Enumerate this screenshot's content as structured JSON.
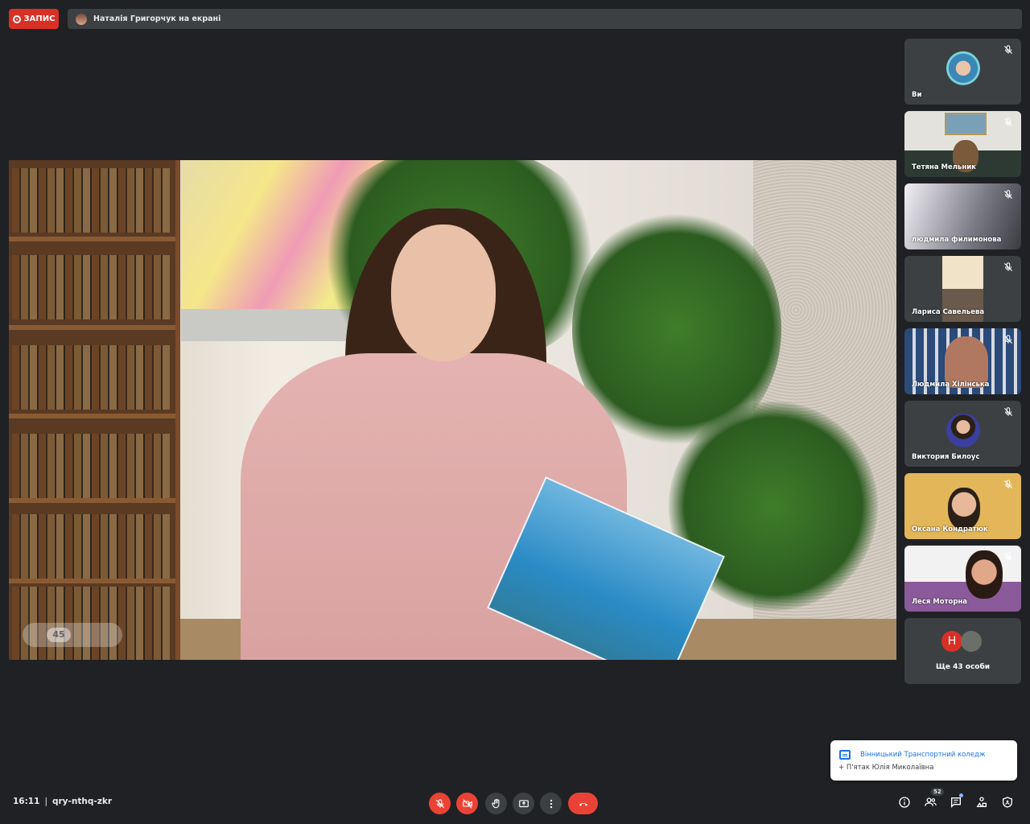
{
  "top_bar": {
    "record_label": "ЗАПИС",
    "presenting_text": "Наталія Григорчук на екрані"
  },
  "main_video": {
    "overlay_counter": "45"
  },
  "participants": [
    {
      "name": "Ви"
    },
    {
      "name": "Тетяна Мельник"
    },
    {
      "name": "людмила филимонова"
    },
    {
      "name": "Лариса Савельева"
    },
    {
      "name": "Людмила Хілінська"
    },
    {
      "name": "Виктория Билоус"
    },
    {
      "name": "Оксана Кондратюк"
    },
    {
      "name": "Леся Моторна"
    }
  ],
  "more_participants": {
    "avatar_letter": "Н",
    "label": "Ще 43 особи"
  },
  "chat_toast": {
    "sender": "Вінницький Транспортний коледж",
    "message": "+ П'ятак Юлія Миколаївна"
  },
  "bottom_bar": {
    "time": "16:11",
    "separator": "|",
    "meeting_code": "qry-nthq-zkr",
    "participants_badge": "52"
  },
  "colors": {
    "background": "#202124",
    "red": "#ea4335",
    "tile": "#3c4043",
    "accent": "#1a73e8"
  },
  "icons": {
    "controls": [
      "mic-off-icon",
      "camera-off-icon",
      "raise-hand-icon",
      "present-icon",
      "more-options-icon",
      "hang-up-icon"
    ],
    "right": [
      "info-icon",
      "people-icon",
      "chat-icon",
      "activities-icon",
      "host-controls-icon"
    ]
  }
}
